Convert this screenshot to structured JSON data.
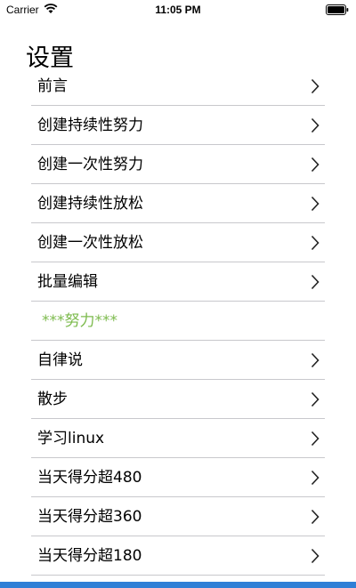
{
  "status_bar": {
    "carrier": "Carrier",
    "time": "11:05 PM"
  },
  "page": {
    "title": "设置"
  },
  "menu": {
    "items": [
      {
        "label": "前言",
        "kind": "item"
      },
      {
        "label": "创建持续性努力",
        "kind": "item"
      },
      {
        "label": "创建一次性努力",
        "kind": "item"
      },
      {
        "label": "创建持续性放松",
        "kind": "item"
      },
      {
        "label": "创建一次性放松",
        "kind": "item"
      },
      {
        "label": "批量编辑",
        "kind": "item"
      },
      {
        "label": "***努力***",
        "kind": "section"
      },
      {
        "label": "自律说",
        "kind": "item"
      },
      {
        "label": "散步",
        "kind": "item"
      },
      {
        "label": "学习linux",
        "kind": "item"
      },
      {
        "label": "当天得分超480",
        "kind": "item"
      },
      {
        "label": "当天得分超360",
        "kind": "item"
      },
      {
        "label": "当天得分超180",
        "kind": "item"
      }
    ]
  },
  "colors": {
    "section_header": "#7dbb4e",
    "separator": "#c8c8cc",
    "bottom_bar": "#2f7fd6"
  }
}
